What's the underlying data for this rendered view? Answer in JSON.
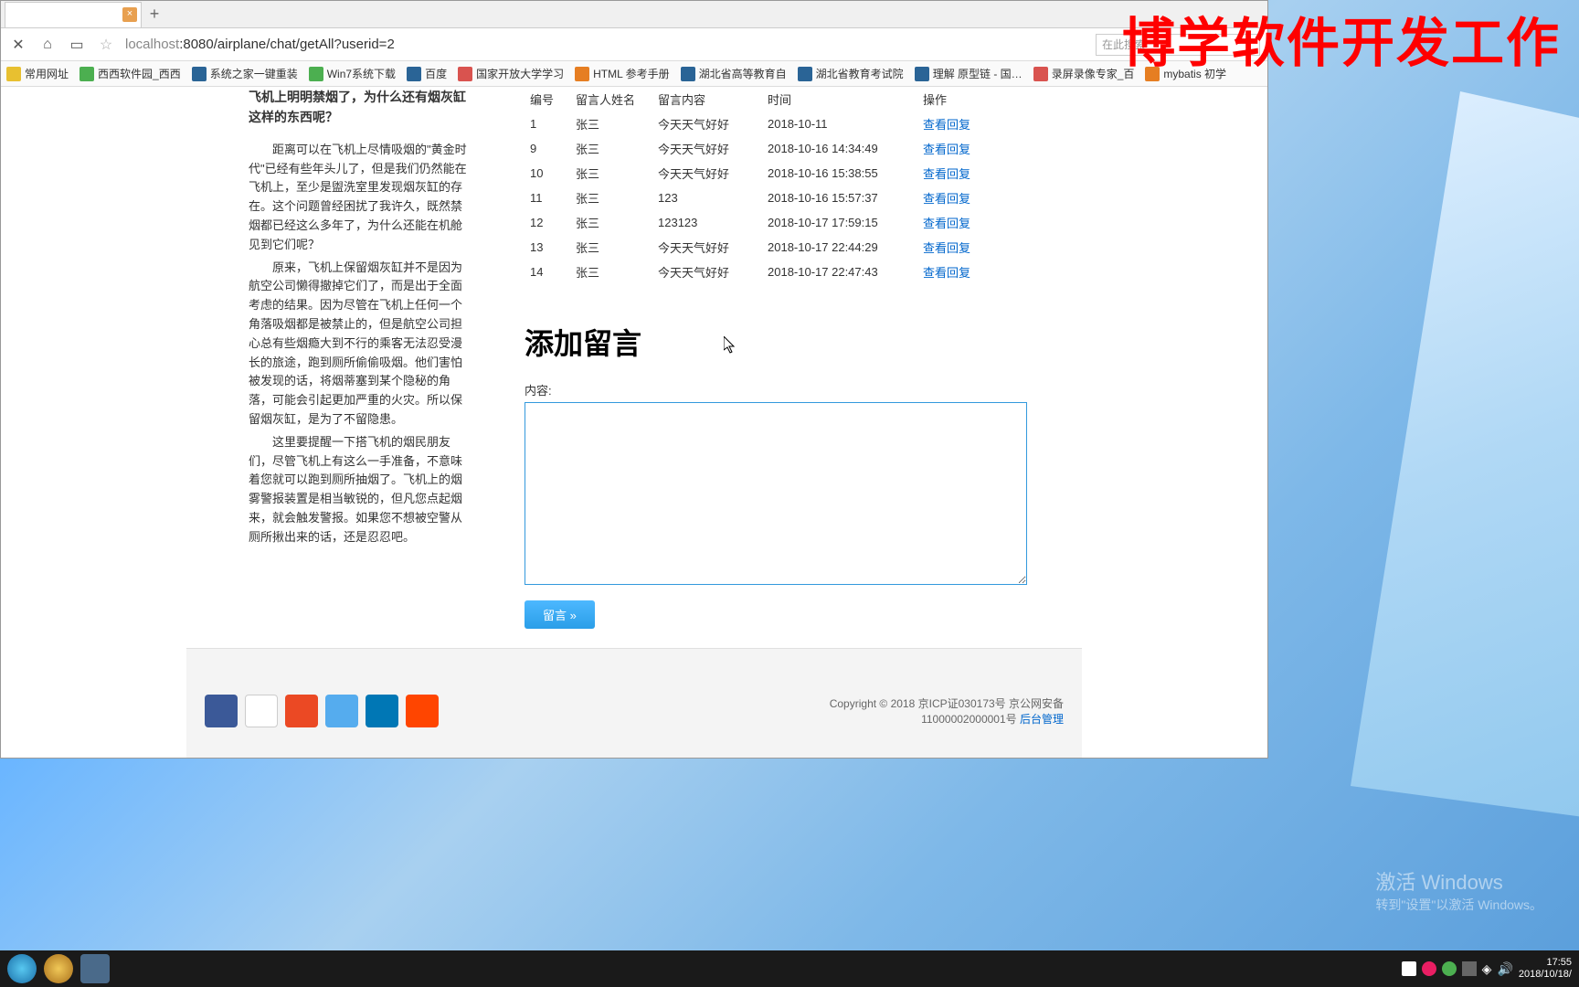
{
  "watermark": "博学软件开发工作",
  "activate": {
    "title": "激活 Windows",
    "sub": "转到\"设置\"以激活 Windows。"
  },
  "browser": {
    "tab_title": "",
    "url_display": "localhost:8080/airplane/chat/getAll?userid=2",
    "search_placeholder": "在此搜索"
  },
  "bookmarks": [
    "常用网址",
    "西西软件园_西西",
    "系统之家一键重装",
    "Win7系统下载",
    "百度",
    "国家开放大学学习",
    "HTML 参考手册",
    "湖北省高等教育自",
    "湖北省教育考试院",
    "理解 原型链 - 国…",
    "录屏录像专家_百",
    "mybatis 初学"
  ],
  "article": {
    "title": "飞机上明明禁烟了，为什么还有烟灰缸这样的东西呢？",
    "p1": "距离可以在飞机上尽情吸烟的\"黄金时代\"已经有些年头儿了，但是我们仍然能在飞机上，至少是盥洗室里发现烟灰缸的存在。这个问题曾经困扰了我许久，既然禁烟都已经这么多年了，为什么还能在机舱见到它们呢？",
    "p2": "原来，飞机上保留烟灰缸并不是因为航空公司懒得撤掉它们了，而是出于全面考虑的结果。因为尽管在飞机上任何一个角落吸烟都是被禁止的，但是航空公司担心总有些烟瘾大到不行的乘客无法忍受漫长的旅途，跑到厕所偷偷吸烟。他们害怕被发现的话，将烟蒂塞到某个隐秘的角落，可能会引起更加严重的火灾。所以保留烟灰缸，是为了不留隐患。",
    "p3": "这里要提醒一下搭飞机的烟民朋友们，尽管飞机上有这么一手准备，不意味着您就可以跑到厕所抽烟了。飞机上的烟雾警报装置是相当敏锐的，但凡您点起烟来，就会触发警报。如果您不想被空警从厕所揪出来的话，还是忍忍吧。"
  },
  "table": {
    "headers": [
      "编号",
      "留言人姓名",
      "留言内容",
      "时间",
      "操作"
    ],
    "rows": [
      {
        "id": "1",
        "name": "张三",
        "content": "今天天气好好",
        "time": "2018-10-11",
        "action": "查看回复"
      },
      {
        "id": "9",
        "name": "张三",
        "content": "今天天气好好",
        "time": "2018-10-16 14:34:49",
        "action": "查看回复"
      },
      {
        "id": "10",
        "name": "张三",
        "content": "今天天气好好",
        "time": "2018-10-16 15:38:55",
        "action": "查看回复"
      },
      {
        "id": "11",
        "name": "张三",
        "content": "123",
        "time": "2018-10-16 15:57:37",
        "action": "查看回复"
      },
      {
        "id": "12",
        "name": "张三",
        "content": "123123",
        "time": "2018-10-17 17:59:15",
        "action": "查看回复"
      },
      {
        "id": "13",
        "name": "张三",
        "content": "今天天气好好",
        "time": "2018-10-17 22:44:29",
        "action": "查看回复"
      },
      {
        "id": "14",
        "name": "张三",
        "content": "今天天气好好",
        "time": "2018-10-17 22:47:43",
        "action": "查看回复"
      }
    ]
  },
  "form": {
    "heading": "添加留言",
    "label": "内容:",
    "submit": "留言 »"
  },
  "footer": {
    "copy": "Copyright © 2018 京ICP证030173号 京公网安备",
    "num": "11000002000001号 ",
    "admin": "后台管理"
  },
  "taskbar": {
    "time": "17:55",
    "date": "2018/10/18/"
  }
}
